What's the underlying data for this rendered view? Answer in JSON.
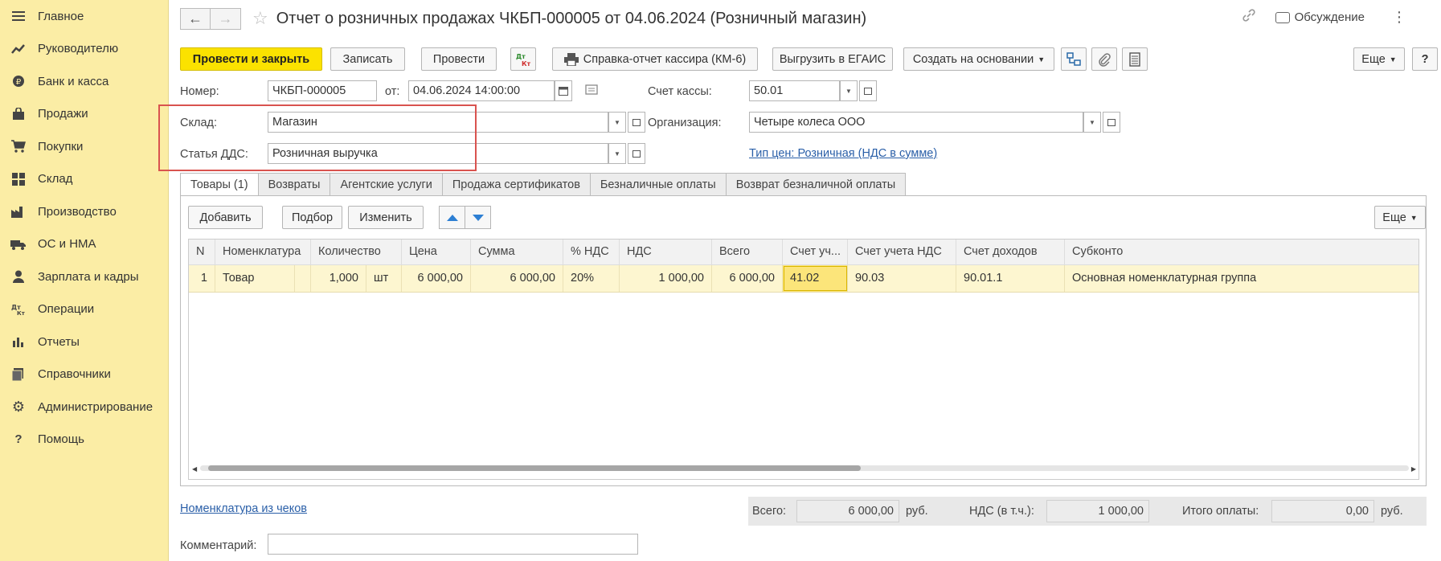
{
  "sidebar": {
    "items": [
      {
        "label": "Главное",
        "icon": "menu-icon"
      },
      {
        "label": "Руководителю",
        "icon": "trend-icon"
      },
      {
        "label": "Банк и касса",
        "icon": "coin-icon"
      },
      {
        "label": "Продажи",
        "icon": "bag-icon"
      },
      {
        "label": "Покупки",
        "icon": "cart-icon"
      },
      {
        "label": "Склад",
        "icon": "boxes-icon"
      },
      {
        "label": "Производство",
        "icon": "factory-icon"
      },
      {
        "label": "ОС и НМА",
        "icon": "truck-icon"
      },
      {
        "label": "Зарплата и кадры",
        "icon": "person-icon"
      },
      {
        "label": "Операции",
        "icon": "dt-kt-icon"
      },
      {
        "label": "Отчеты",
        "icon": "bar-chart-icon"
      },
      {
        "label": "Справочники",
        "icon": "books-icon"
      },
      {
        "label": "Администрирование",
        "icon": "gear-icon"
      },
      {
        "label": "Помощь",
        "icon": "question-icon"
      }
    ]
  },
  "header": {
    "title": "Отчет о розничных продажах ЧКБП-000005 от 04.06.2024 (Розничный магазин)",
    "discussion": "Обсуждение"
  },
  "toolbar": {
    "post_close": "Провести и закрыть",
    "save": "Записать",
    "post": "Провести",
    "dt_kt_top": "Дт",
    "dt_kt_bottom": "Кт",
    "cashier_report": "Справка-отчет кассира (КМ-6)",
    "egais": "Выгрузить в ЕГАИС",
    "create_based": "Создать на основании",
    "more": "Еще",
    "help": "?"
  },
  "form": {
    "number_label": "Номер:",
    "number_value": "ЧКБП-000005",
    "date_label": "от:",
    "date_value": "04.06.2024 14:00:00",
    "cash_account_label": "Счет кассы:",
    "cash_account_value": "50.01",
    "warehouse_label": "Склад:",
    "warehouse_value": "Магазин",
    "org_label": "Организация:",
    "org_value": "Четыре колеса ООО",
    "dds_label": "Статья ДДС:",
    "dds_value": "Розничная выручка",
    "price_type_link": "Тип цен: Розничная (НДС в сумме)"
  },
  "tabs": [
    {
      "label": "Товары (1)",
      "active": true
    },
    {
      "label": "Возвраты"
    },
    {
      "label": "Агентские услуги"
    },
    {
      "label": "Продажа сертификатов"
    },
    {
      "label": "Безналичные оплаты"
    },
    {
      "label": "Возврат безналичной оплаты"
    }
  ],
  "table_toolbar": {
    "add": "Добавить",
    "pick": "Подбор",
    "change": "Изменить",
    "more": "Еще"
  },
  "table": {
    "columns": [
      "N",
      "Номенклатура",
      "Количество",
      "Цена",
      "Сумма",
      "% НДС",
      "НДС",
      "Всего",
      "Счет уч...",
      "Счет учета НДС",
      "Счет доходов",
      "Субконто"
    ],
    "rows": [
      {
        "n": "1",
        "item": "Товар",
        "qty": "1,000",
        "unit": "шт",
        "price": "6 000,00",
        "sum": "6 000,00",
        "vat_rate": "20%",
        "vat": "1 000,00",
        "total": "6 000,00",
        "account": "41.02",
        "vat_account": "90.03",
        "income_account": "90.01.1",
        "subconto": "Основная номенклатурная группа"
      }
    ]
  },
  "footer": {
    "receipts_link": "Номенклатура из чеков",
    "comment_label": "Комментарий:",
    "comment_value": "",
    "total_label": "Всего:",
    "total_value": "6 000,00",
    "currency": "руб.",
    "vat_label": "НДС (в т.ч.):",
    "vat_value": "1 000,00",
    "payment_label": "Итого оплаты:",
    "payment_value": "0,00"
  }
}
